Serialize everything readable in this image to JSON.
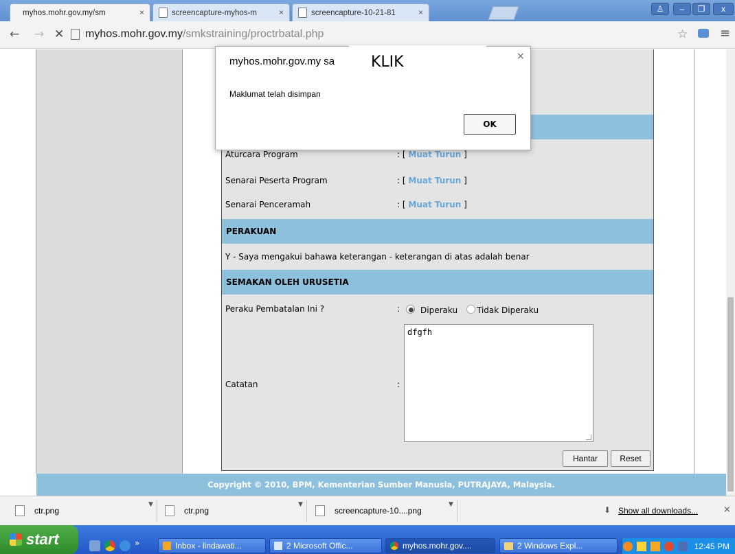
{
  "browser": {
    "tabs": [
      {
        "label": "myhos.mohr.gov.my/sm",
        "active": true
      },
      {
        "label": "screencapture-myhos-m",
        "active": false
      },
      {
        "label": "screencapture-10-21-81",
        "active": false
      }
    ],
    "url_host": "myhos.mohr.gov.my",
    "url_path": "/smkstraining/proctrbatal.php"
  },
  "form": {
    "rows": [
      {
        "label": "Aturcara Program",
        "sep": ": [",
        "link": "Muat Turun",
        "end": "]"
      },
      {
        "label": "Senarai Peserta Program",
        "sep": ": [",
        "link": "Muat Turun",
        "end": "]"
      },
      {
        "label": "Senarai Penceramah",
        "sep": ": [",
        "link": "Muat Turun",
        "end": "]"
      }
    ],
    "section_perakuan": "PERAKUAN",
    "perakuan_text": "Y - Saya mengakui bahawa keterangan - keterangan di atas adalah benar",
    "section_semakan": "SEMAKAN OLEH URUSETIA",
    "peraku_label": "Peraku Pembatalan Ini ?",
    "peraku_sep": ":",
    "radio_yes": "Diperaku",
    "radio_no": "Tidak Diperaku",
    "catatan_label": "Catatan",
    "catatan_sep": ":",
    "catatan_value": "dfgfh",
    "btn_submit": "Hantar",
    "btn_reset": "Reset"
  },
  "footer": "Copyright © 2010, BPM, Kementerian Sumber Manusia, PUTRAJAYA, Malaysia.",
  "dialog": {
    "title": "myhos.mohr.gov.my sa",
    "annotation": "KLIK",
    "message": "Maklumat telah disimpan",
    "ok": "OK",
    "close": "×"
  },
  "downloads": {
    "items": [
      "ctr.png",
      "ctr.png",
      "screencapture-10....png"
    ],
    "show_all": "Show all downloads...",
    "close": "×"
  },
  "taskbar": {
    "start": "start",
    "buttons": [
      "Inbox - lindawati...",
      "2 Microsoft Offic...",
      "myhos.mohr.gov....",
      "2 Windows Expl..."
    ],
    "clock": "12:45 PM"
  }
}
